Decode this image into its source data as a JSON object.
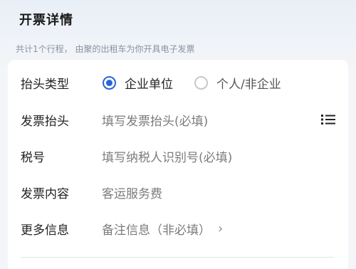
{
  "header": {
    "title": "开票详情",
    "subtitle": "共计1个行程， 由聚的出租车为你开具电子发票"
  },
  "form": {
    "title_type": {
      "label": "抬头类型",
      "options": [
        {
          "label": "企业单位",
          "selected": true
        },
        {
          "label": "个人/非企业",
          "selected": false
        }
      ]
    },
    "invoice_title": {
      "label": "发票抬头",
      "placeholder": "填写发票抬头(必填)",
      "icon": "list-icon"
    },
    "tax_number": {
      "label": "税号",
      "placeholder": "填写纳税人识别号(必填)"
    },
    "content": {
      "label": "发票内容",
      "value": "客运服务费"
    },
    "more_info": {
      "label": "更多信息",
      "value": "备注信息（非必填）",
      "chevron": "›"
    }
  },
  "colors": {
    "accent": "#2b63d9"
  }
}
